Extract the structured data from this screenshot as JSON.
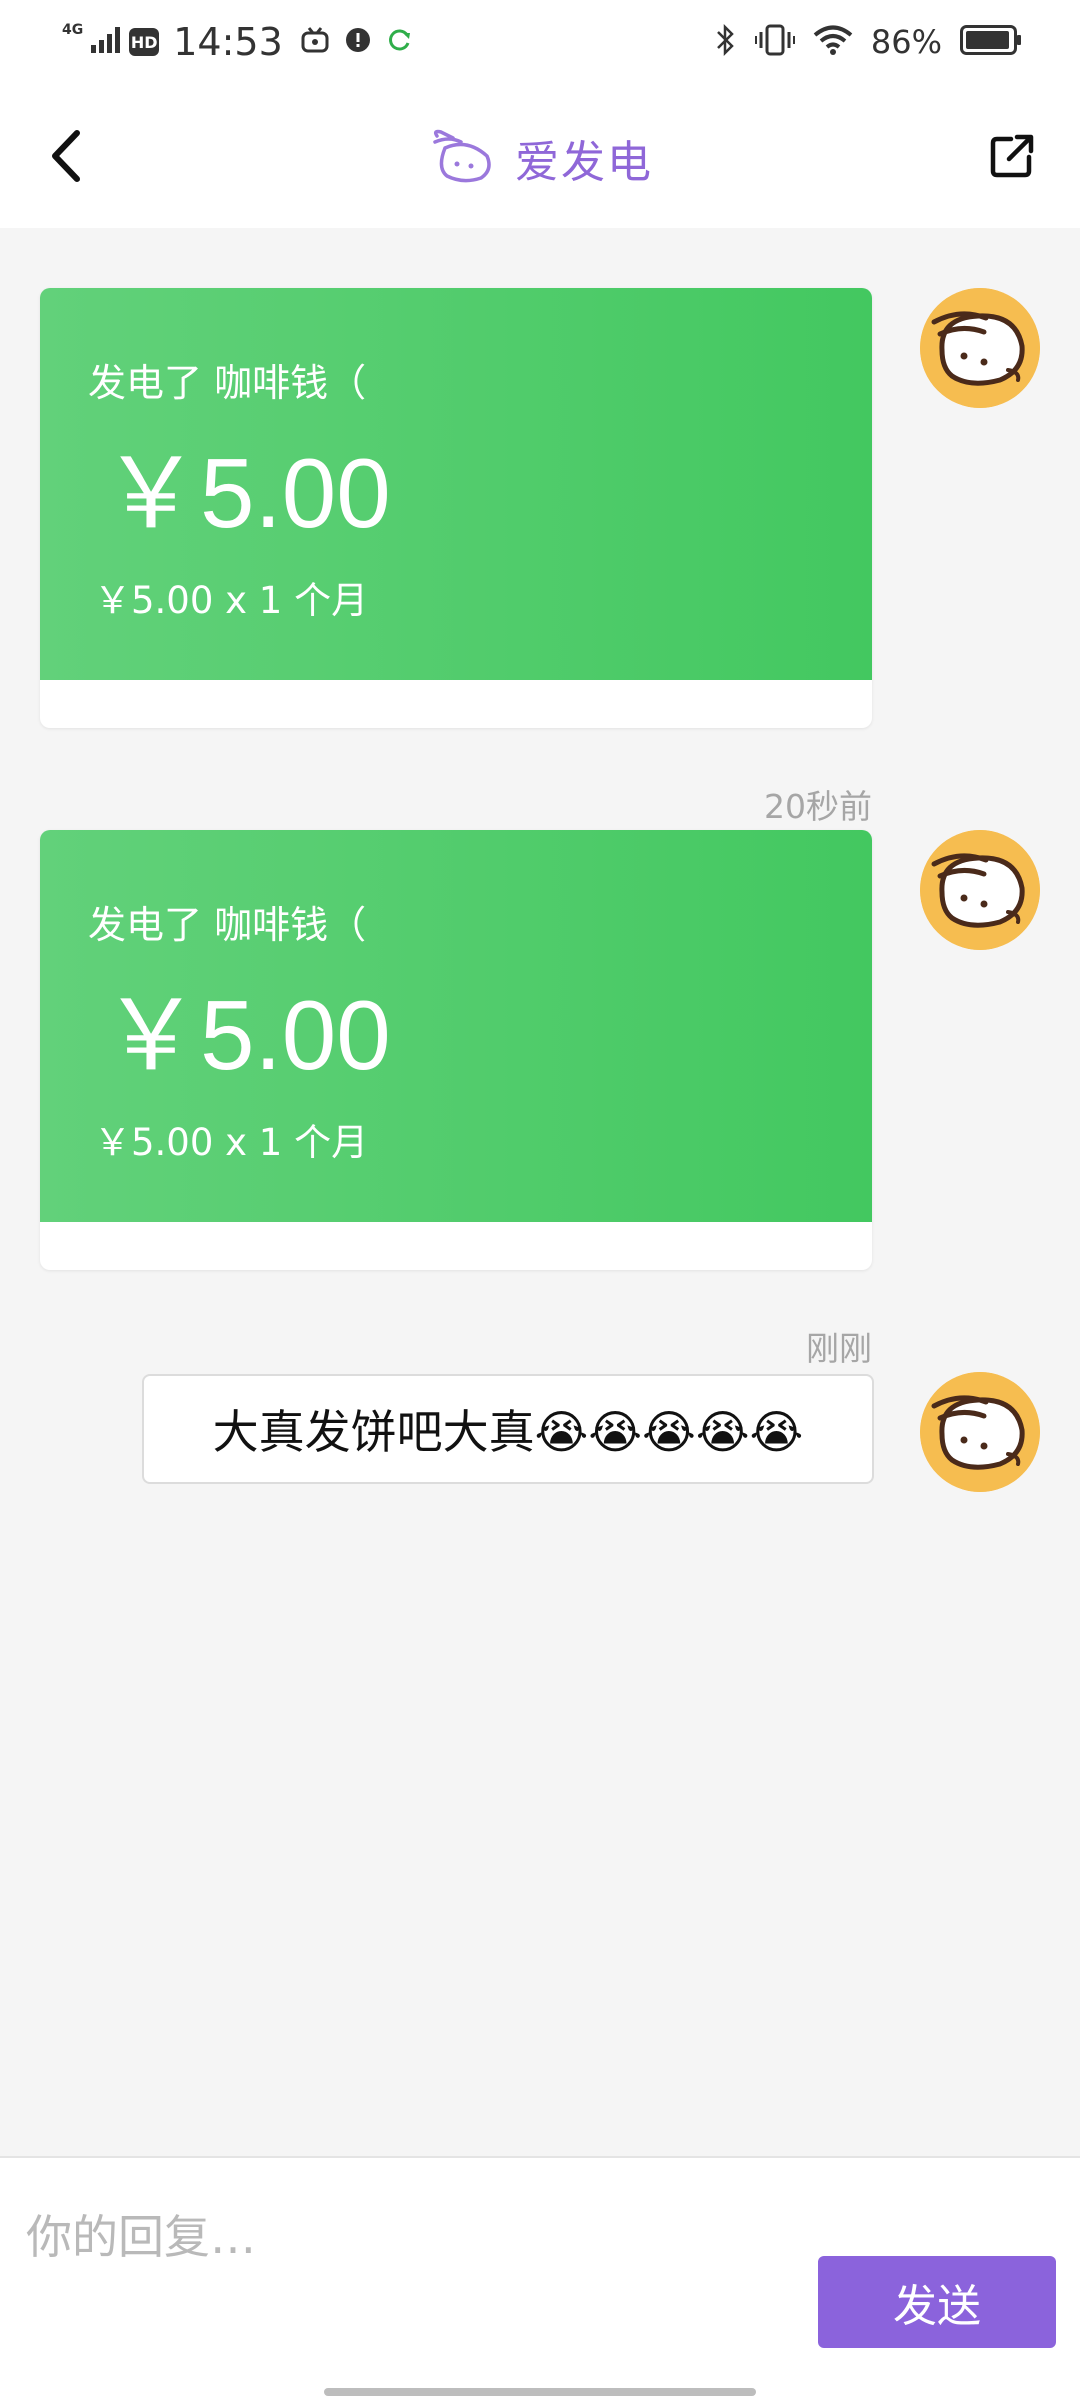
{
  "status_bar": {
    "network": "4G",
    "hd": "HD",
    "time": "14:53",
    "battery": "86%"
  },
  "nav": {
    "title": "爱发电",
    "back_icon": "chevron-left-icon",
    "share_icon": "external-share-icon"
  },
  "messages": [
    {
      "type": "payment",
      "title": "发电了 咖啡钱（",
      "amount": "￥5.00",
      "detail": "￥5.00 x 1 个月",
      "timestamp": ""
    },
    {
      "type": "payment",
      "title": "发电了 咖啡钱（",
      "amount": "￥5.00",
      "detail": "￥5.00 x 1 个月",
      "timestamp": "20秒前"
    },
    {
      "type": "text",
      "text": "大真发饼吧大真😭😭😭😭😭",
      "timestamp": "刚刚"
    }
  ],
  "reply": {
    "placeholder": "你的回复…",
    "value": "",
    "send_label": "发送"
  },
  "colors": {
    "accent": "#8b63dc",
    "card_green": "#4fcb69",
    "avatar_bg": "#f6bd50"
  }
}
